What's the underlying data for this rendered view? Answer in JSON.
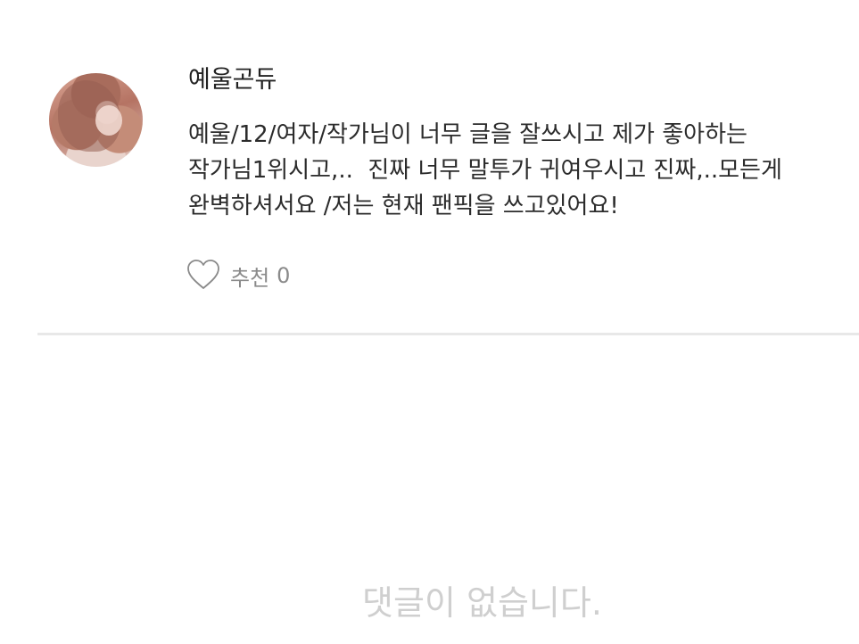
{
  "post": {
    "author": "예울곤듀",
    "avatar_icon": "user-avatar-photo",
    "body": "예울/12/여자/작가님이 너무 글을 잘쓰시고 제가 좋아하는\n작가님1위시고,..  진짜 너무 말투가 귀여우시고 진짜,..모든게\n완벽하셔서요 /저는 현재 팬픽을 쓰고있어요!",
    "like": {
      "icon": "heart-outline-icon",
      "label": "추천",
      "count": "0"
    }
  },
  "comments": {
    "empty_message": "댓글이 없습니다."
  },
  "colors": {
    "text": "#2b2b2b",
    "muted": "#8a8a8a",
    "placeholder": "#cfcfcf",
    "divider": "#e8e8e8"
  }
}
